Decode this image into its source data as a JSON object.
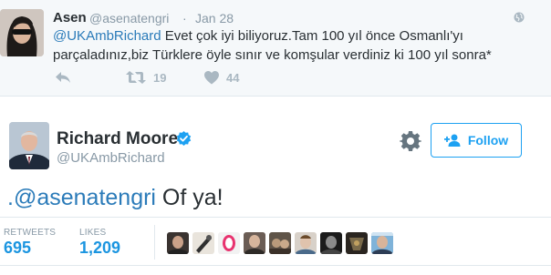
{
  "reply_tweet": {
    "name": "Asen",
    "handle": "@asenatengri",
    "separator": "·",
    "date": "Jan 28",
    "mention": "@UKAmbRichard",
    "text_line1": " Evet çok iyi biliyoruz.Tam 100 yıl önce Osmanlı'yı",
    "text_line2": "parçaladınız,biz Türklere öyle sınır ve komşular verdiniz ki 100 yıl sonra*",
    "retweet_count": "19",
    "like_count": "44",
    "icons": [
      "globe-icon",
      "reply-icon",
      "retweet-icon",
      "heart-icon"
    ]
  },
  "main_tweet": {
    "name": "Richard Moore",
    "handle": "@UKAmbRichard",
    "follow_label": "Follow",
    "mention": ".@asenatengri",
    "text": " Of ya!",
    "icons": [
      "verified-badge-icon",
      "gear-icon",
      "follow-person-icon"
    ]
  },
  "stats": {
    "retweets_label": "RETWEETS",
    "retweets_value": "695",
    "likes_label": "LIKES",
    "likes_value": "1,209"
  },
  "colors": {
    "link": "#2b7bb9",
    "accent": "#1da1f2",
    "muted": "#8899a6",
    "reply_bg": "#f5f8fa"
  }
}
